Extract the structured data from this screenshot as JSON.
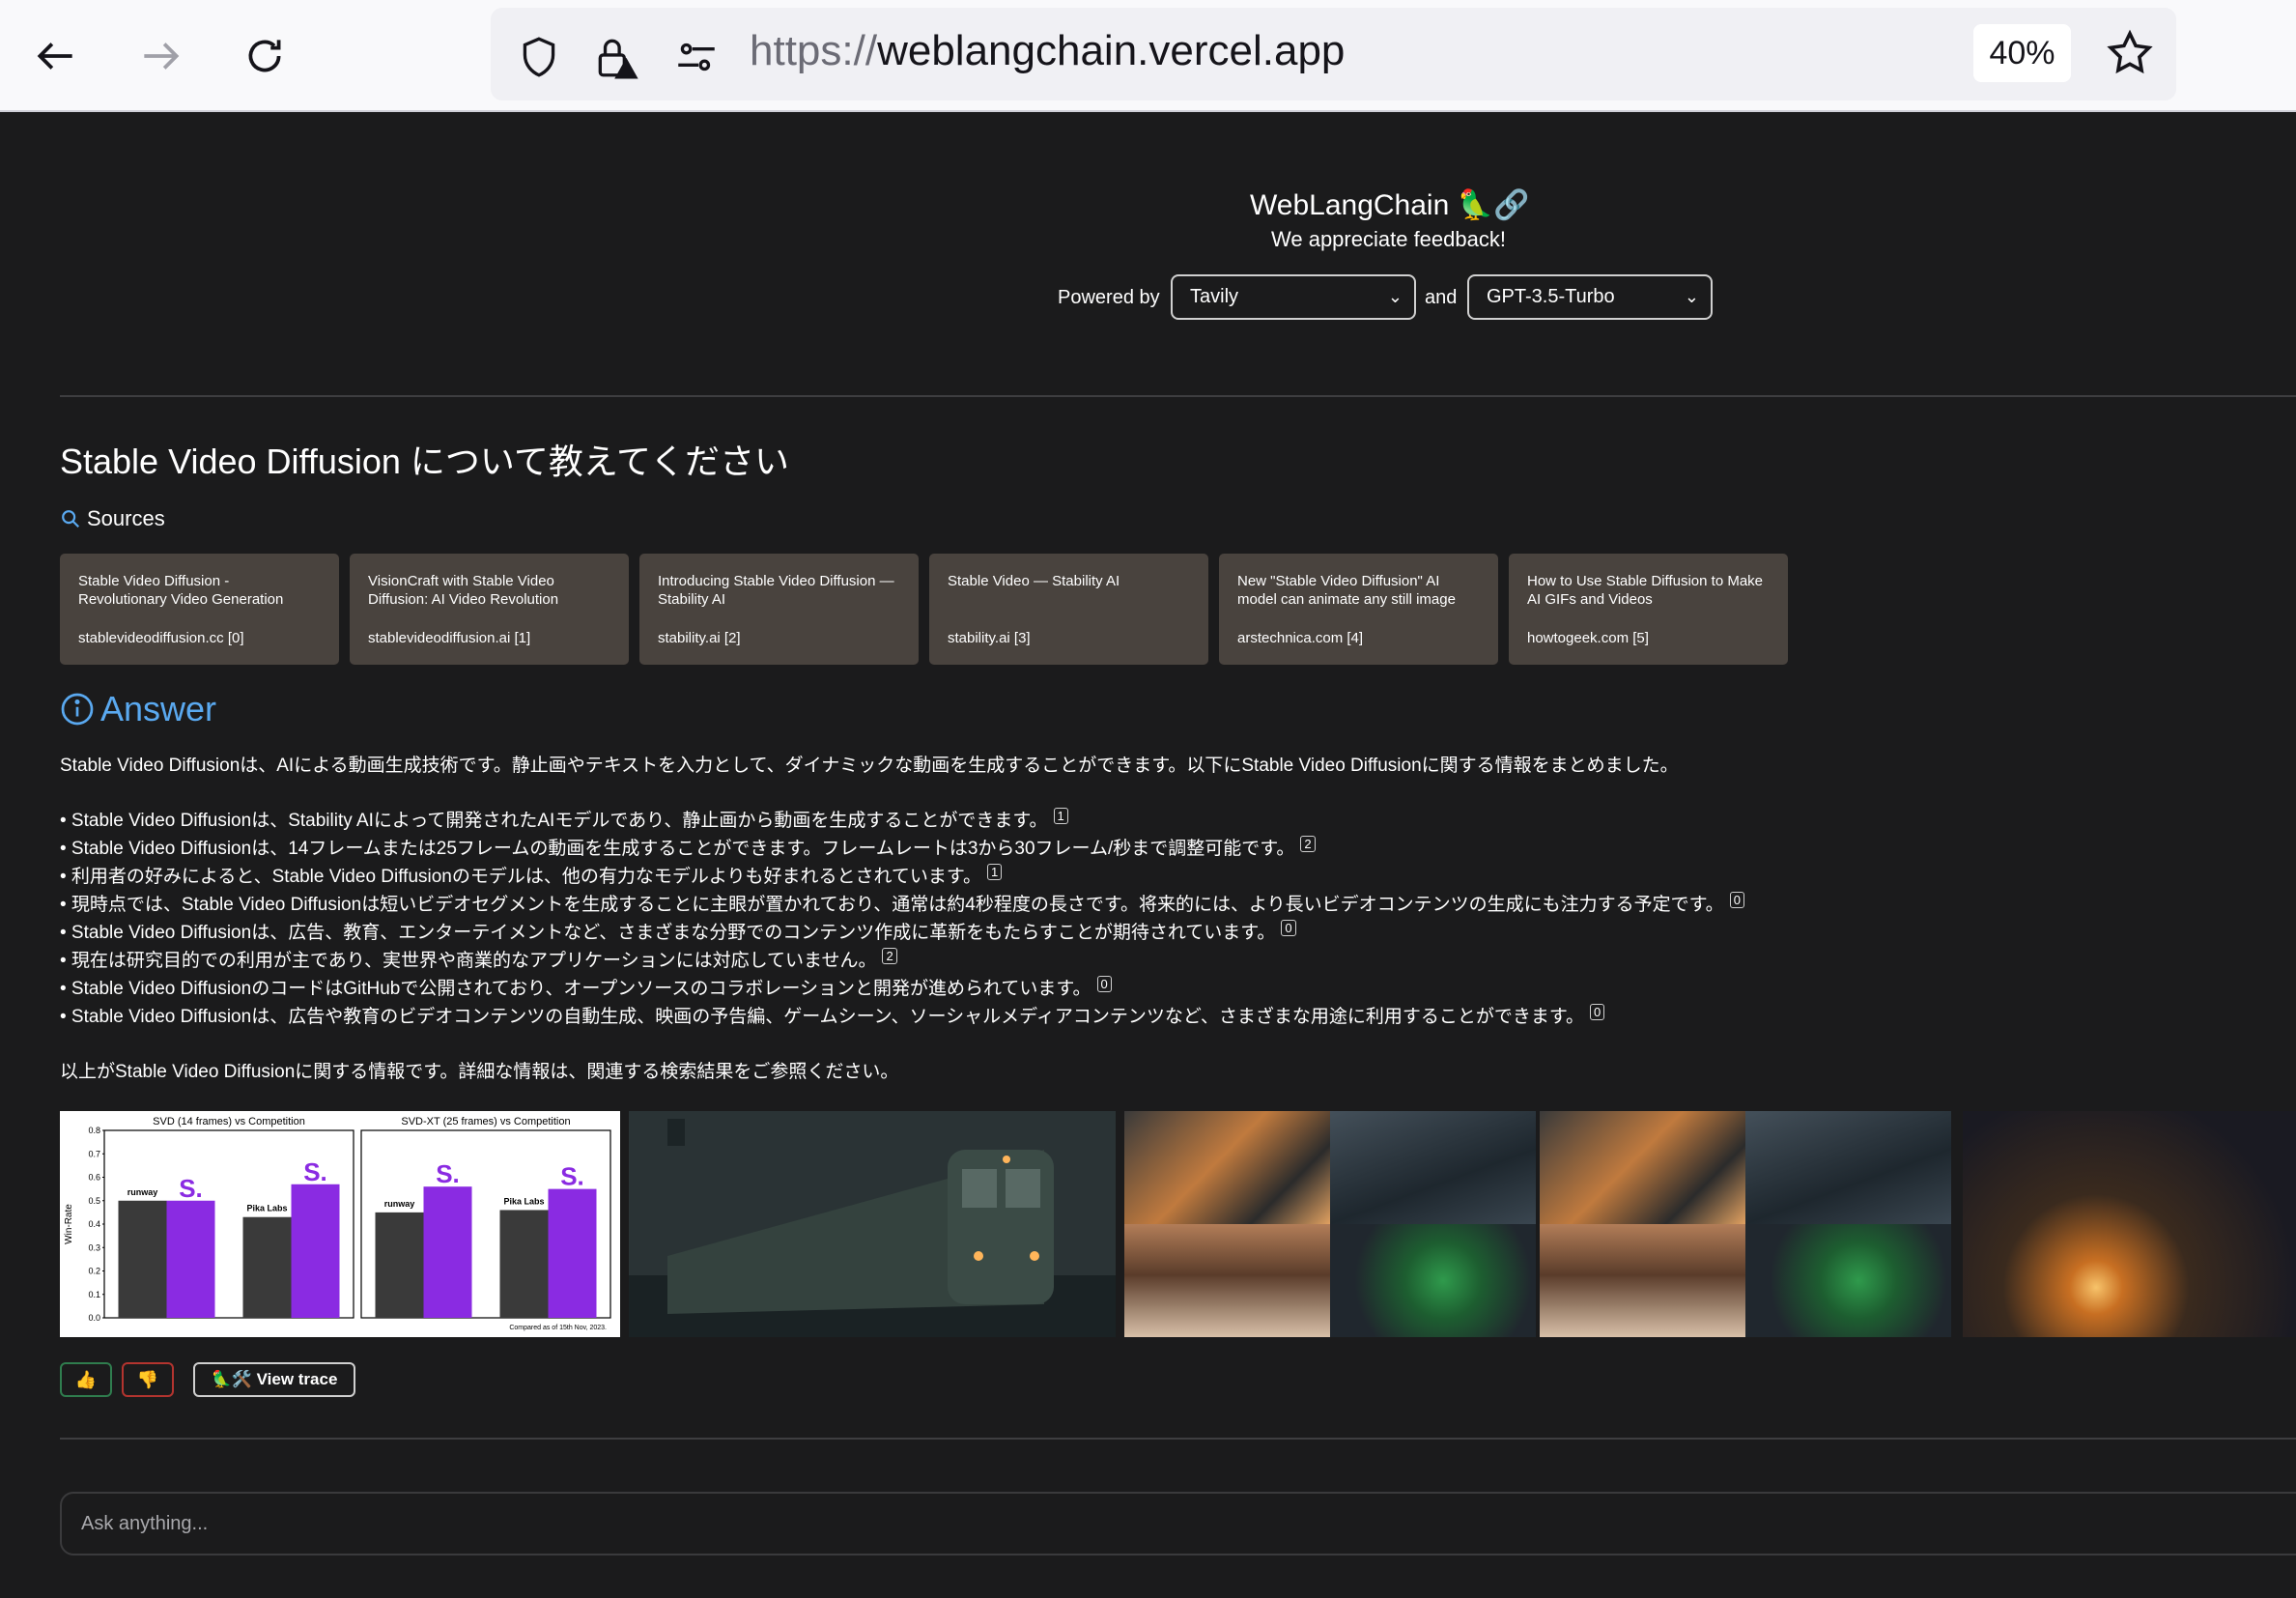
{
  "browser": {
    "url_protocol": "https://",
    "url_host": "weblangchain.vercel.app",
    "zoom": "40%"
  },
  "header": {
    "title": "WebLangChain 🦜🔗",
    "subtitle": "We appreciate feedback!",
    "powered_by": "Powered by",
    "retriever": "Tavily",
    "and": "and",
    "model": "GPT-3.5-Turbo"
  },
  "question": "Stable Video Diffusion について教えてください",
  "sources_label": "Sources",
  "sources": [
    {
      "title": "Stable Video Diffusion - Revolutionary Video Generation",
      "url": "stablevideodiffusion.cc [0]"
    },
    {
      "title": "VisionCraft with Stable Video Diffusion: AI Video Revolution",
      "url": "stablevideodiffusion.ai [1]"
    },
    {
      "title": "Introducing Stable Video Diffusion — Stability AI",
      "url": "stability.ai [2]"
    },
    {
      "title": "Stable Video — Stability AI",
      "url": "stability.ai [3]"
    },
    {
      "title": "New \"Stable Video Diffusion\" AI model can animate any still image",
      "url": "arstechnica.com [4]"
    },
    {
      "title": "How to Use Stable Diffusion to Make AI GIFs and Videos",
      "url": "howtogeek.com [5]"
    }
  ],
  "answer_label": "Answer",
  "answer_intro": "Stable Video Diffusionは、AIによる動画生成技術です。静止画やテキストを入力として、ダイナミックな動画を生成することができます。以下にStable Video Diffusionに関する情報をまとめました。",
  "bullets": [
    {
      "text": "• Stable Video Diffusionは、Stability AIによって開発されたAIモデルであり、静止画から動画を生成することができます。",
      "cite": "1"
    },
    {
      "text": "• Stable Video Diffusionは、14フレームまたは25フレームの動画を生成することができます。フレームレートは3から30フレーム/秒まで調整可能です。",
      "cite": "2"
    },
    {
      "text": "• 利用者の好みによると、Stable Video Diffusionのモデルは、他の有力なモデルよりも好まれるとされています。",
      "cite": "1"
    },
    {
      "text": "• 現時点では、Stable Video Diffusionは短いビデオセグメントを生成することに主眼が置かれており、通常は約4秒程度の長さです。将来的には、より長いビデオコンテンツの生成にも注力する予定です。",
      "cite": "0"
    },
    {
      "text": "• Stable Video Diffusionは、広告、教育、エンターテイメントなど、さまざまな分野でのコンテンツ作成に革新をもたらすことが期待されています。",
      "cite": "0"
    },
    {
      "text": "• 現在は研究目的での利用が主であり、実世界や商業的なアプリケーションには対応していません。",
      "cite": "2"
    },
    {
      "text": "• Stable Video DiffusionのコードはGitHubで公開されており、オープンソースのコラボレーションと開発が進められています。",
      "cite": "0"
    },
    {
      "text": "• Stable Video Diffusionは、広告や教育のビデオコンテンツの自動生成、映画の予告編、ゲームシーン、ソーシャルメディアコンテンツなど、さまざまな用途に利用することができます。",
      "cite": "0"
    }
  ],
  "answer_outro": "以上がStable Video Diffusionに関する情報です。詳細な情報は、関連する検索結果をご参照ください。",
  "chart_data": [
    {
      "type": "bar",
      "title": "SVD (14 frames) vs Competition",
      "ylabel": "Win-Rate",
      "ylim": [
        0,
        0.8
      ],
      "yticks": [
        "0.0",
        "0.1",
        "0.2",
        "0.3",
        "0.4",
        "0.5",
        "0.6",
        "0.7",
        "0.8"
      ],
      "categories": [
        "runway",
        "Pika Labs"
      ],
      "series": [
        {
          "values": [
            0.5,
            0.43
          ],
          "color": "#3a3a3a"
        },
        {
          "values": [
            0.5,
            0.57
          ],
          "color": "#8a2be2"
        }
      ]
    },
    {
      "type": "bar",
      "title": "SVD-XT (25 frames) vs Competition",
      "ylim": [
        0,
        0.8
      ],
      "categories": [
        "runway",
        "Pika Labs"
      ],
      "series": [
        {
          "values": [
            0.45,
            0.46
          ],
          "color": "#3a3a3a"
        },
        {
          "values": [
            0.56,
            0.55
          ],
          "color": "#8a2be2"
        }
      ],
      "footnote": "Compared as of 15th Nov, 2023."
    }
  ],
  "feedback": {
    "up": "👍",
    "down": "👎",
    "trace": "🦜🛠️ View trace"
  },
  "input": {
    "placeholder": "Ask anything..."
  }
}
